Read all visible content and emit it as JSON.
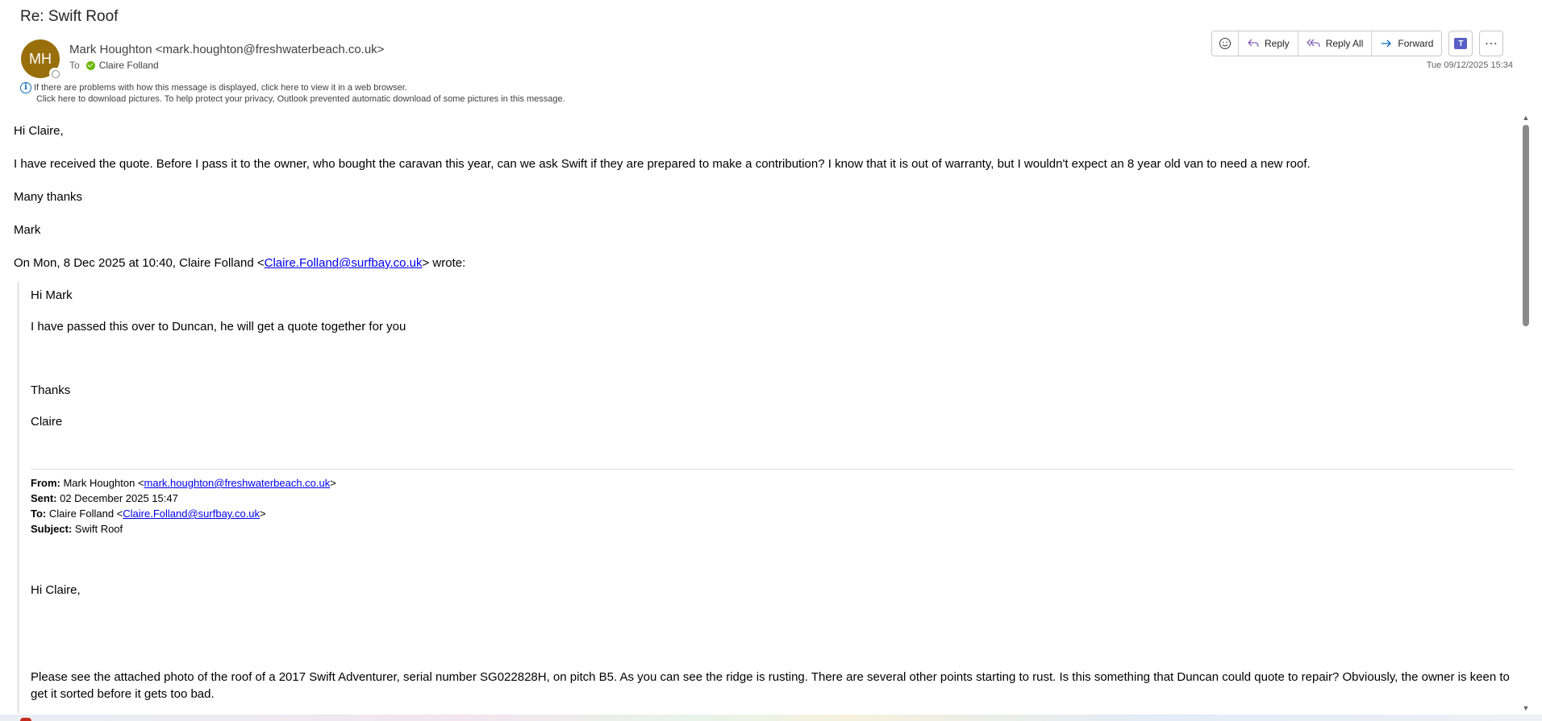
{
  "email": {
    "subject": "Re: Swift Roof",
    "avatar_initials": "MH",
    "sender": "Mark Houghton <mark.houghton@freshwaterbeach.co.uk>",
    "to_label": "To",
    "recipient": "Claire Folland",
    "date": "Tue 09/12/2025 15:34",
    "info_line1": "If there are problems with how this message is displayed, click here to view it in a web browser.",
    "info_line2": "Click here to download pictures. To help protect your privacy, Outlook prevented automatic download of some pictures in this message."
  },
  "toolbar": {
    "reply": "Reply",
    "reply_all": "Reply All",
    "forward": "Forward"
  },
  "body": {
    "greeting": "Hi Claire,",
    "paragraph": "I have received the quote. Before I pass it to the owner, who bought the caravan this year, can we ask Swift if they are prepared to make a contribution? I know that it is out of warranty, but I wouldn't expect an 8 year old van to need a new roof.",
    "signoff": "Many thanks",
    "name": "Mark",
    "wrote_prefix": "On Mon, 8 Dec 2025 at 10:40, Claire Folland <",
    "wrote_link": "Claire.Folland@surfbay.co.uk",
    "wrote_suffix": "> wrote:"
  },
  "quote": {
    "greeting": "Hi Mark",
    "line": "I have passed this over to Duncan, he will get a quote together for you",
    "thanks": "Thanks",
    "name": "Claire",
    "from_label": "From:",
    "from_name": " Mark Houghton <",
    "from_link": "mark.houghton@freshwaterbeach.co.uk",
    "sent_label": "Sent:",
    "sent_value": " 02 December 2025 15:47",
    "to_label": "To:",
    "to_name": " Claire Folland <",
    "to_link": "Claire.Folland@surfbay.co.uk",
    "subject_label": "Subject:",
    "subject_value": " Swift Roof",
    "inner_greeting": "Hi Claire,",
    "inner_paragraph": "Please see the attached photo of the roof of a 2017 Swift Adventurer, serial number SG022828H, on pitch B5. As you can see the ridge is rusting. There are several other points starting to rust. Is this something that Duncan could quote to repair? Obviously, the owner is keen to get it sorted before it gets too bad."
  }
}
